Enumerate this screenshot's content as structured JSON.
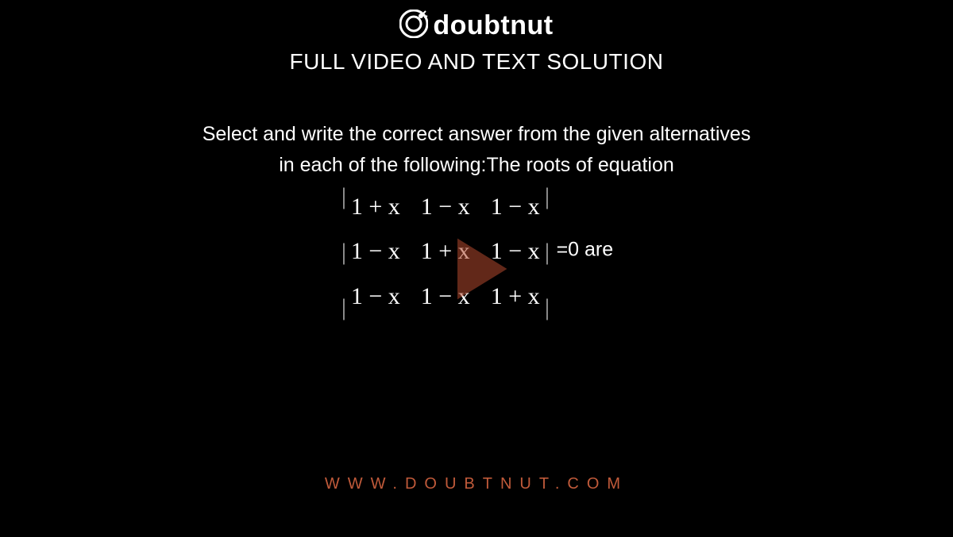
{
  "brand": {
    "name": "doubtnut",
    "accent": "#c05a3a"
  },
  "subtitle": "FULL VIDEO AND TEXT SOLUTION",
  "question": {
    "lead1": "Select and write the correct answer from the given alternatives",
    "lead2": "in each of the following:The roots of equation",
    "determinant": {
      "rows": [
        [
          "1 + x",
          "1 − x",
          "1 − x"
        ],
        [
          "1 − x",
          "1 + x",
          "1 − x"
        ],
        [
          "1 − x",
          "1 − x",
          "1 + x"
        ]
      ]
    },
    "tail": "=0 are"
  },
  "footer": {
    "url": "WWW.DOUBTNUT.COM"
  },
  "icons": {
    "play": "play-icon",
    "logo": "doubtnut-logo"
  }
}
